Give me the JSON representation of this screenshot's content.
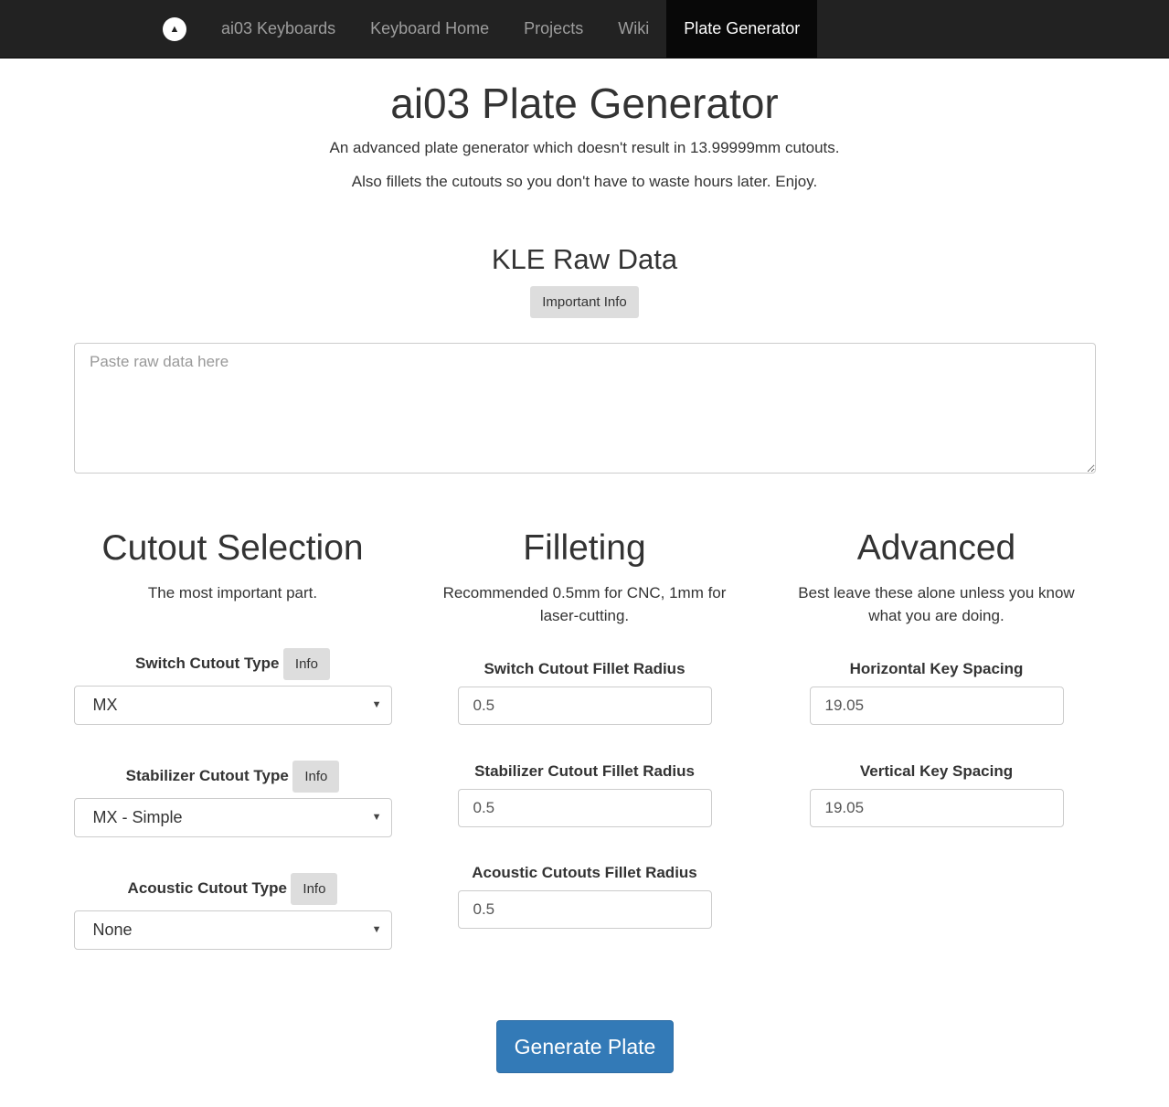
{
  "nav": {
    "logo": "A",
    "items": [
      "ai03 Keyboards",
      "Keyboard Home",
      "Projects",
      "Wiki",
      "Plate Generator"
    ],
    "active": "Plate Generator"
  },
  "header": {
    "title": "ai03 Plate Generator",
    "line1": "An advanced plate generator which doesn't result in 13.99999mm cutouts.",
    "line2": "Also fillets the cutouts so you don't have to waste hours later. Enjoy."
  },
  "kle": {
    "title": "KLE Raw Data",
    "info_button": "Important Info",
    "placeholder": "Paste raw data here"
  },
  "cutout": {
    "title": "Cutout Selection",
    "desc": "The most important part.",
    "info": "Info",
    "switch_label": "Switch Cutout Type",
    "switch_value": "MX",
    "stab_label": "Stabilizer Cutout Type",
    "stab_value": "MX - Simple",
    "acoustic_label": "Acoustic Cutout Type",
    "acoustic_value": "None"
  },
  "fillet": {
    "title": "Filleting",
    "desc": "Recommended 0.5mm for CNC, 1mm for laser-cutting.",
    "switch_label": "Switch Cutout Fillet Radius",
    "switch_value": "0.5",
    "stab_label": "Stabilizer Cutout Fillet Radius",
    "stab_value": "0.5",
    "acoustic_label": "Acoustic Cutouts Fillet Radius",
    "acoustic_value": "0.5"
  },
  "advanced": {
    "title": "Advanced",
    "desc": "Best leave these alone unless you know what you are doing.",
    "h_label": "Horizontal Key Spacing",
    "h_value": "19.05",
    "v_label": "Vertical Key Spacing",
    "v_value": "19.05"
  },
  "generate": "Generate Plate"
}
